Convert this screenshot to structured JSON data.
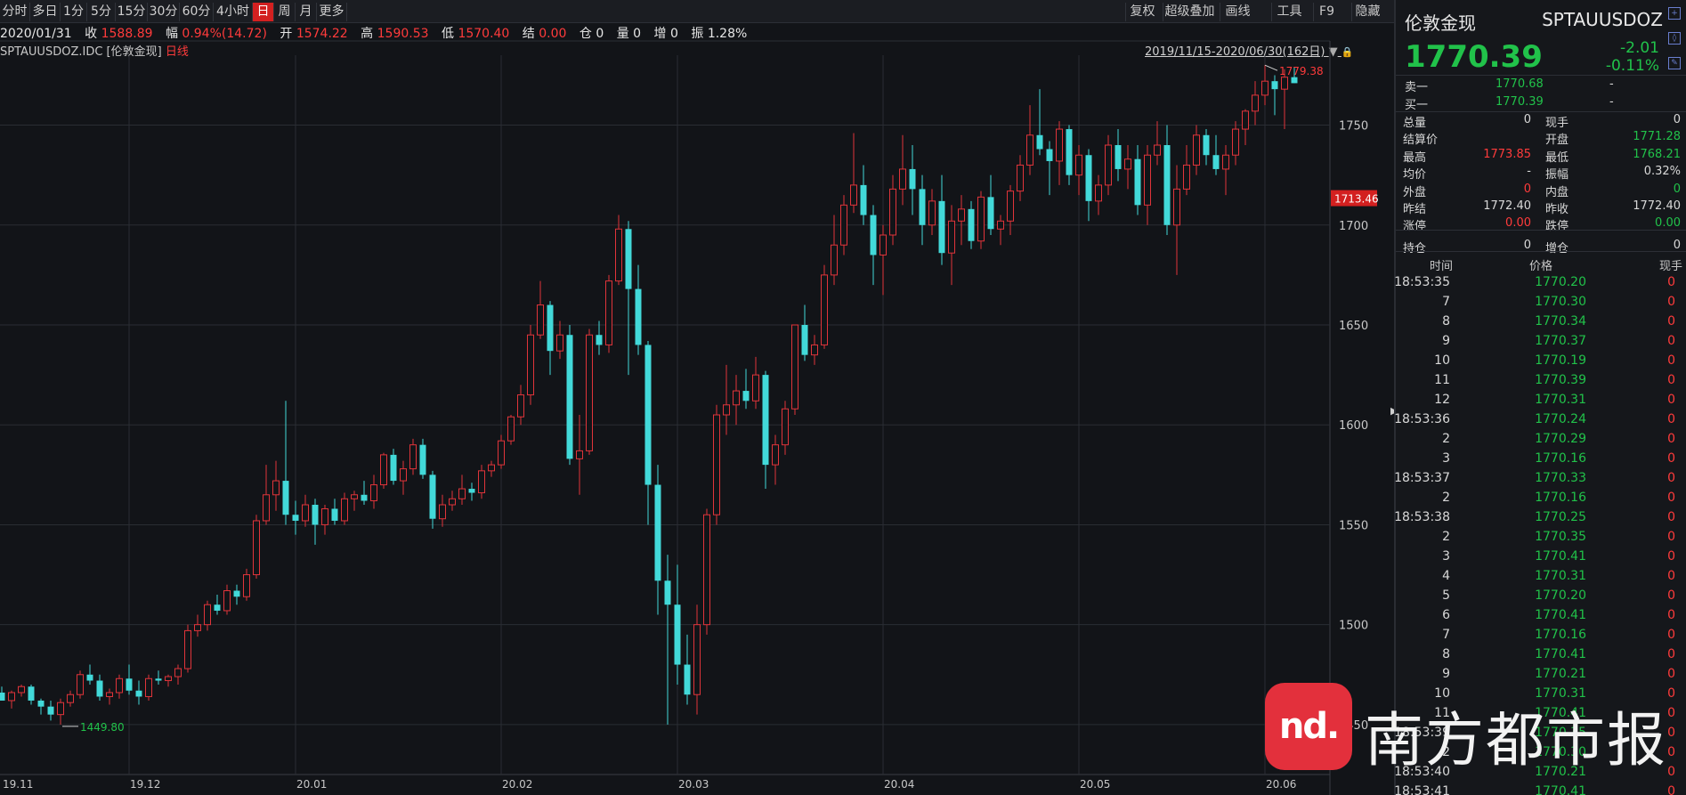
{
  "toolbar": {
    "periods": [
      "分时",
      "多日",
      "1分",
      "5分",
      "15分",
      "30分",
      "60分",
      "4小时",
      "日",
      "周",
      "月",
      "更多"
    ],
    "active_period": "日",
    "tools": [
      "复权",
      "超级叠加",
      "画线",
      "工具",
      "F9",
      "隐藏"
    ]
  },
  "info": {
    "date": "2020/01/31",
    "close_label": "收",
    "close": "1588.89",
    "change_label": "幅",
    "change": "0.94%(14.72)",
    "open_label": "开",
    "open": "1574.22",
    "high_label": "高",
    "high": "1590.53",
    "low_label": "低",
    "low": "1570.40",
    "settle_label": "结",
    "settle": "0.00",
    "oi_label": "仓",
    "oi": "0",
    "vol_label": "量",
    "vol": "0",
    "inc_label": "增",
    "inc": "0",
    "amp_label": "振",
    "amp": "1.28%"
  },
  "symbol_line": {
    "code": "SPTAUUSDOZ.IDC",
    "name": "[伦敦金现]",
    "kline_type": "日线"
  },
  "range_text": "2019/11/15-2020/06/30(162日)",
  "chart_data": {
    "type": "candlestick",
    "x_labels": [
      "19.11",
      "19.12",
      "20.01",
      "20.02",
      "20.03",
      "20.04",
      "20.05",
      "20.06"
    ],
    "y_ticks": [
      1450,
      1500,
      1550,
      1600,
      1650,
      1700,
      1750
    ],
    "ylim": [
      1425,
      1785
    ],
    "current_price_tag": "1713.46",
    "max_annotation": "1779.38",
    "min_annotation": "1449.80",
    "colors": {
      "up": "#e0343a",
      "down": "#42d9d9"
    },
    "candles": [
      [
        1466,
        1469,
        1462,
        1462
      ],
      [
        1462,
        1467,
        1458,
        1466
      ],
      [
        1466,
        1470,
        1464,
        1469
      ],
      [
        1469,
        1470,
        1460,
        1462
      ],
      [
        1462,
        1463,
        1455,
        1459
      ],
      [
        1459,
        1462,
        1452,
        1455
      ],
      [
        1455,
        1463,
        1450,
        1461
      ],
      [
        1461,
        1467,
        1459,
        1465
      ],
      [
        1465,
        1477,
        1463,
        1475
      ],
      [
        1475,
        1480,
        1470,
        1472
      ],
      [
        1472,
        1475,
        1462,
        1464
      ],
      [
        1464,
        1468,
        1460,
        1466
      ],
      [
        1466,
        1475,
        1463,
        1473
      ],
      [
        1473,
        1480,
        1465,
        1467
      ],
      [
        1467,
        1472,
        1460,
        1464
      ],
      [
        1464,
        1475,
        1462,
        1473
      ],
      [
        1473,
        1477,
        1470,
        1472
      ],
      [
        1472,
        1475,
        1469,
        1474
      ],
      [
        1474,
        1480,
        1470,
        1478
      ],
      [
        1478,
        1500,
        1476,
        1497
      ],
      [
        1497,
        1505,
        1494,
        1500
      ],
      [
        1500,
        1512,
        1497,
        1510
      ],
      [
        1510,
        1515,
        1505,
        1507
      ],
      [
        1507,
        1520,
        1505,
        1517
      ],
      [
        1517,
        1520,
        1510,
        1514
      ],
      [
        1514,
        1528,
        1512,
        1525
      ],
      [
        1525,
        1555,
        1523,
        1552
      ],
      [
        1552,
        1580,
        1550,
        1565
      ],
      [
        1565,
        1582,
        1557,
        1572
      ],
      [
        1572,
        1612,
        1550,
        1555
      ],
      [
        1555,
        1562,
        1545,
        1552
      ],
      [
        1552,
        1565,
        1549,
        1560
      ],
      [
        1560,
        1563,
        1540,
        1550
      ],
      [
        1550,
        1560,
        1545,
        1558
      ],
      [
        1558,
        1563,
        1550,
        1552
      ],
      [
        1552,
        1566,
        1550,
        1563
      ],
      [
        1563,
        1567,
        1557,
        1565
      ],
      [
        1565,
        1572,
        1560,
        1562
      ],
      [
        1562,
        1575,
        1558,
        1570
      ],
      [
        1570,
        1586,
        1568,
        1585
      ],
      [
        1585,
        1588,
        1570,
        1572
      ],
      [
        1572,
        1582,
        1565,
        1578
      ],
      [
        1578,
        1593,
        1575,
        1590
      ],
      [
        1590,
        1593,
        1573,
        1575
      ],
      [
        1575,
        1577,
        1548,
        1553
      ],
      [
        1553,
        1565,
        1549,
        1560
      ],
      [
        1560,
        1567,
        1557,
        1563
      ],
      [
        1563,
        1575,
        1560,
        1568
      ],
      [
        1568,
        1571,
        1562,
        1566
      ],
      [
        1566,
        1580,
        1563,
        1577
      ],
      [
        1577,
        1582,
        1574,
        1580
      ],
      [
        1580,
        1595,
        1578,
        1592
      ],
      [
        1592,
        1605,
        1590,
        1604
      ],
      [
        1604,
        1620,
        1600,
        1615
      ],
      [
        1615,
        1650,
        1610,
        1645
      ],
      [
        1645,
        1672,
        1643,
        1660
      ],
      [
        1660,
        1662,
        1625,
        1637
      ],
      [
        1637,
        1652,
        1633,
        1645
      ],
      [
        1645,
        1650,
        1580,
        1583
      ],
      [
        1583,
        1605,
        1565,
        1587
      ],
      [
        1587,
        1648,
        1585,
        1645
      ],
      [
        1645,
        1652,
        1635,
        1640
      ],
      [
        1640,
        1675,
        1636,
        1672
      ],
      [
        1672,
        1705,
        1670,
        1698
      ],
      [
        1698,
        1702,
        1625,
        1668
      ],
      [
        1668,
        1680,
        1635,
        1640
      ],
      [
        1640,
        1642,
        1550,
        1570
      ],
      [
        1570,
        1580,
        1505,
        1522
      ],
      [
        1522,
        1535,
        1450,
        1510
      ],
      [
        1510,
        1530,
        1470,
        1480
      ],
      [
        1480,
        1495,
        1460,
        1465
      ],
      [
        1465,
        1510,
        1455,
        1500
      ],
      [
        1500,
        1558,
        1495,
        1555
      ],
      [
        1555,
        1610,
        1550,
        1605
      ],
      [
        1605,
        1630,
        1595,
        1610
      ],
      [
        1610,
        1625,
        1600,
        1617
      ],
      [
        1617,
        1628,
        1608,
        1612
      ],
      [
        1612,
        1634,
        1608,
        1625
      ],
      [
        1625,
        1627,
        1568,
        1580
      ],
      [
        1580,
        1595,
        1570,
        1590
      ],
      [
        1590,
        1612,
        1585,
        1608
      ],
      [
        1608,
        1640,
        1605,
        1650
      ],
      [
        1650,
        1660,
        1632,
        1635
      ],
      [
        1635,
        1645,
        1630,
        1640
      ],
      [
        1640,
        1680,
        1638,
        1675
      ],
      [
        1675,
        1705,
        1670,
        1690
      ],
      [
        1690,
        1715,
        1685,
        1710
      ],
      [
        1710,
        1746,
        1706,
        1720
      ],
      [
        1720,
        1730,
        1700,
        1705
      ],
      [
        1705,
        1710,
        1670,
        1685
      ],
      [
        1685,
        1700,
        1665,
        1695
      ],
      [
        1695,
        1725,
        1690,
        1718
      ],
      [
        1718,
        1745,
        1710,
        1728
      ],
      [
        1728,
        1740,
        1705,
        1718
      ],
      [
        1718,
        1725,
        1690,
        1700
      ],
      [
        1700,
        1718,
        1695,
        1712
      ],
      [
        1712,
        1725,
        1680,
        1686
      ],
      [
        1686,
        1710,
        1670,
        1702
      ],
      [
        1702,
        1715,
        1690,
        1708
      ],
      [
        1708,
        1712,
        1688,
        1692
      ],
      [
        1692,
        1717,
        1688,
        1714
      ],
      [
        1714,
        1725,
        1695,
        1698
      ],
      [
        1698,
        1705,
        1690,
        1702
      ],
      [
        1702,
        1720,
        1695,
        1717
      ],
      [
        1717,
        1735,
        1712,
        1730
      ],
      [
        1730,
        1760,
        1725,
        1745
      ],
      [
        1745,
        1768,
        1735,
        1738
      ],
      [
        1738,
        1742,
        1715,
        1732
      ],
      [
        1732,
        1752,
        1720,
        1748
      ],
      [
        1748,
        1750,
        1720,
        1725
      ],
      [
        1725,
        1740,
        1715,
        1735
      ],
      [
        1735,
        1738,
        1702,
        1712
      ],
      [
        1712,
        1725,
        1705,
        1720
      ],
      [
        1720,
        1745,
        1715,
        1740
      ],
      [
        1740,
        1748,
        1722,
        1728
      ],
      [
        1728,
        1740,
        1718,
        1733
      ],
      [
        1733,
        1740,
        1705,
        1710
      ],
      [
        1710,
        1740,
        1700,
        1735
      ],
      [
        1735,
        1752,
        1730,
        1740
      ],
      [
        1740,
        1750,
        1695,
        1700
      ],
      [
        1700,
        1730,
        1675,
        1718
      ],
      [
        1718,
        1740,
        1715,
        1730
      ],
      [
        1730,
        1750,
        1725,
        1745
      ],
      [
        1745,
        1748,
        1730,
        1735
      ],
      [
        1735,
        1745,
        1725,
        1728
      ],
      [
        1728,
        1740,
        1715,
        1735
      ],
      [
        1735,
        1752,
        1730,
        1748
      ],
      [
        1748,
        1758,
        1740,
        1757
      ],
      [
        1757,
        1772,
        1750,
        1765
      ],
      [
        1765,
        1780,
        1760,
        1772
      ],
      [
        1772,
        1775,
        1755,
        1768
      ],
      [
        1768,
        1778,
        1748,
        1774
      ],
      [
        1774,
        1779,
        1771,
        1771
      ]
    ]
  },
  "panel": {
    "title": "伦敦金现",
    "code": "SPTAUUSDOZ",
    "price": "1770.39",
    "change": "-2.01",
    "change_pct": "-0.11%",
    "ask_label": "卖一",
    "ask": "1770.68",
    "ask_vol": "-",
    "bid_label": "买一",
    "bid": "1770.39",
    "bid_vol": "-",
    "stats_left": [
      {
        "label": "总量",
        "value": "0",
        "color": "#d8d8d8"
      },
      {
        "label": "结算价",
        "value": "",
        "color": "#d8d8d8"
      },
      {
        "label": "最高",
        "value": "1773.85",
        "color": "#ff3b3b"
      },
      {
        "label": "均价",
        "value": "-",
        "color": "#d8d8d8"
      },
      {
        "label": "外盘",
        "value": "0",
        "color": "#ff3b3b"
      },
      {
        "label": "昨结",
        "value": "1772.40",
        "color": "#d8d8d8"
      },
      {
        "label": "涨停",
        "value": "0.00",
        "color": "#ff3b3b"
      },
      {
        "label": "持仓",
        "value": "0",
        "color": "#d8d8d8"
      }
    ],
    "stats_right": [
      {
        "label": "现手",
        "value": "0",
        "color": "#d8d8d8"
      },
      {
        "label": "开盘",
        "value": "1771.28",
        "color": "#21c24a"
      },
      {
        "label": "最低",
        "value": "1768.21",
        "color": "#21c24a"
      },
      {
        "label": "振幅",
        "value": "0.32%",
        "color": "#d8d8d8"
      },
      {
        "label": "内盘",
        "value": "0",
        "color": "#21c24a"
      },
      {
        "label": "昨收",
        "value": "1772.40",
        "color": "#d8d8d8"
      },
      {
        "label": "跌停",
        "value": "0.00",
        "color": "#21c24a"
      },
      {
        "label": "增仓",
        "value": "0",
        "color": "#d8d8d8"
      }
    ],
    "ticks_header": {
      "time": "时间",
      "price": "价格",
      "vol": "现手"
    },
    "ticks": [
      {
        "t": "18:53:35",
        "p": "1770.20",
        "v": "0"
      },
      {
        "t": "7",
        "p": "1770.30",
        "v": "0"
      },
      {
        "t": "8",
        "p": "1770.34",
        "v": "0"
      },
      {
        "t": "9",
        "p": "1770.37",
        "v": "0"
      },
      {
        "t": "10",
        "p": "1770.19",
        "v": "0"
      },
      {
        "t": "11",
        "p": "1770.39",
        "v": "0"
      },
      {
        "t": "12",
        "p": "1770.31",
        "v": "0"
      },
      {
        "t": "18:53:36",
        "p": "1770.24",
        "v": "0"
      },
      {
        "t": "2",
        "p": "1770.29",
        "v": "0"
      },
      {
        "t": "3",
        "p": "1770.16",
        "v": "0"
      },
      {
        "t": "18:53:37",
        "p": "1770.33",
        "v": "0"
      },
      {
        "t": "2",
        "p": "1770.16",
        "v": "0"
      },
      {
        "t": "18:53:38",
        "p": "1770.25",
        "v": "0"
      },
      {
        "t": "2",
        "p": "1770.35",
        "v": "0"
      },
      {
        "t": "3",
        "p": "1770.41",
        "v": "0"
      },
      {
        "t": "4",
        "p": "1770.31",
        "v": "0"
      },
      {
        "t": "5",
        "p": "1770.20",
        "v": "0"
      },
      {
        "t": "6",
        "p": "1770.41",
        "v": "0"
      },
      {
        "t": "7",
        "p": "1770.16",
        "v": "0"
      },
      {
        "t": "8",
        "p": "1770.41",
        "v": "0"
      },
      {
        "t": "9",
        "p": "1770.21",
        "v": "0"
      },
      {
        "t": "10",
        "p": "1770.31",
        "v": "0"
      },
      {
        "t": "11",
        "p": "1770.41",
        "v": "0"
      },
      {
        "t": "18:53:39",
        "p": "1770.35",
        "v": "0"
      },
      {
        "t": "2",
        "p": "1770.30",
        "v": "0"
      },
      {
        "t": "18:53:40",
        "p": "1770.21",
        "v": "0"
      },
      {
        "t": "18:53:41",
        "p": "1770.41",
        "v": "0"
      }
    ]
  },
  "watermark": {
    "logo": "nd.",
    "text": "南方都市报"
  }
}
